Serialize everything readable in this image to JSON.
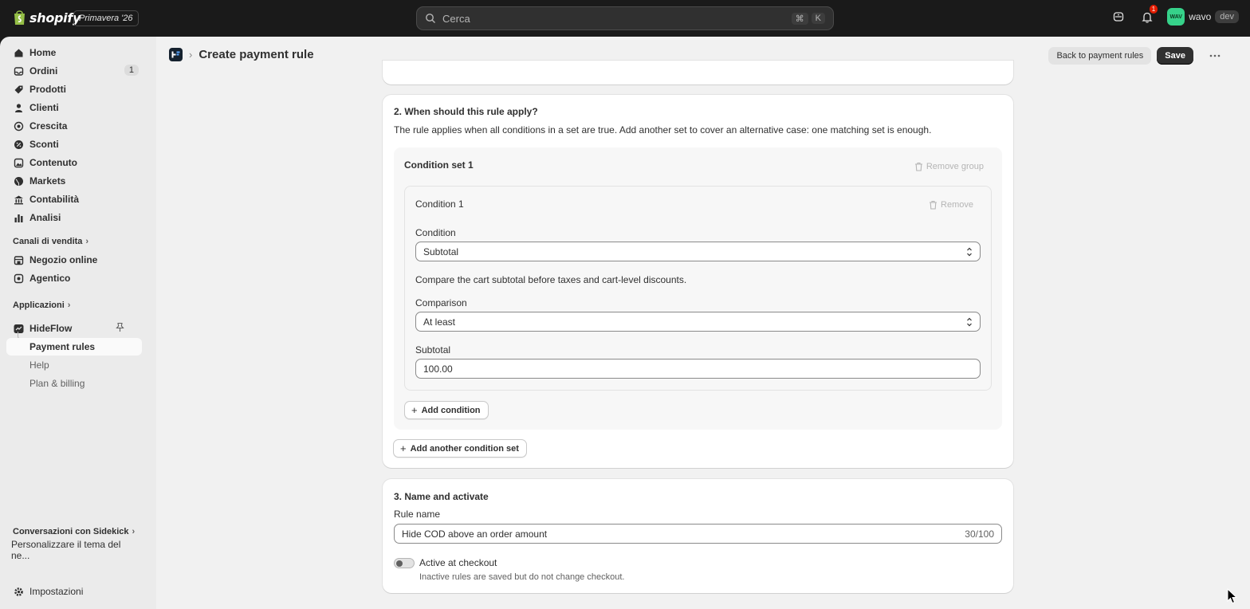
{
  "topbar": {
    "logo_text": "shopify",
    "edition": "Primavera '26",
    "search_placeholder": "Cerca",
    "shortcut_keys": [
      "⌘",
      "K"
    ],
    "notification_count": "1",
    "store_avatar": "WAV",
    "store_name": "wavo",
    "env_badge": "dev"
  },
  "sidebar": {
    "items": [
      {
        "label": "Home",
        "icon": "home-icon"
      },
      {
        "label": "Ordini",
        "icon": "inbox-icon",
        "count": "1"
      },
      {
        "label": "Prodotti",
        "icon": "tag-icon"
      },
      {
        "label": "Clienti",
        "icon": "person-icon"
      },
      {
        "label": "Crescita",
        "icon": "target-icon"
      },
      {
        "label": "Sconti",
        "icon": "discount-icon"
      },
      {
        "label": "Contenuto",
        "icon": "content-icon"
      },
      {
        "label": "Markets",
        "icon": "globe-icon"
      },
      {
        "label": "Contabilità",
        "icon": "bank-icon"
      },
      {
        "label": "Analisi",
        "icon": "chart-icon"
      }
    ],
    "sales_channels_heading": "Canali di vendita",
    "channels": [
      {
        "label": "Negozio online",
        "icon": "store-icon"
      },
      {
        "label": "Agentico",
        "icon": "agentic-icon"
      }
    ],
    "apps_heading": "Applicazioni",
    "app": {
      "label": "HideFlow"
    },
    "app_subitems": [
      "Payment rules",
      "Help",
      "Plan & billing"
    ],
    "sidekick_heading": "Conversazioni con Sidekick",
    "sidekick_item": "Personalizzare il tema del ne...",
    "settings_label": "Impostazioni"
  },
  "header": {
    "title": "Create payment rule",
    "back_label": "Back to payment rules",
    "save_label": "Save"
  },
  "section2": {
    "title": "2. When should this rule apply?",
    "help": "The rule applies when all conditions in a set are true. Add another set to cover an alternative case: one matching set is enough.",
    "set_title": "Condition set 1",
    "remove_group_label": "Remove group",
    "condition_title": "Condition 1",
    "remove_label": "Remove",
    "condition_label": "Condition",
    "condition_value": "Subtotal",
    "condition_help": "Compare the cart subtotal before taxes and cart-level discounts.",
    "comparison_label": "Comparison",
    "comparison_value": "At least",
    "subtotal_label": "Subtotal",
    "subtotal_value": "100.00",
    "add_condition_label": "Add condition",
    "add_set_label": "Add another condition set"
  },
  "section3": {
    "title": "3. Name and activate",
    "rule_name_label": "Rule name",
    "rule_name_value": "Hide COD above an order amount",
    "rule_name_counter": "30/100",
    "active_label": "Active at checkout",
    "active_help": "Inactive rules are saved but do not change checkout.",
    "active": false
  }
}
